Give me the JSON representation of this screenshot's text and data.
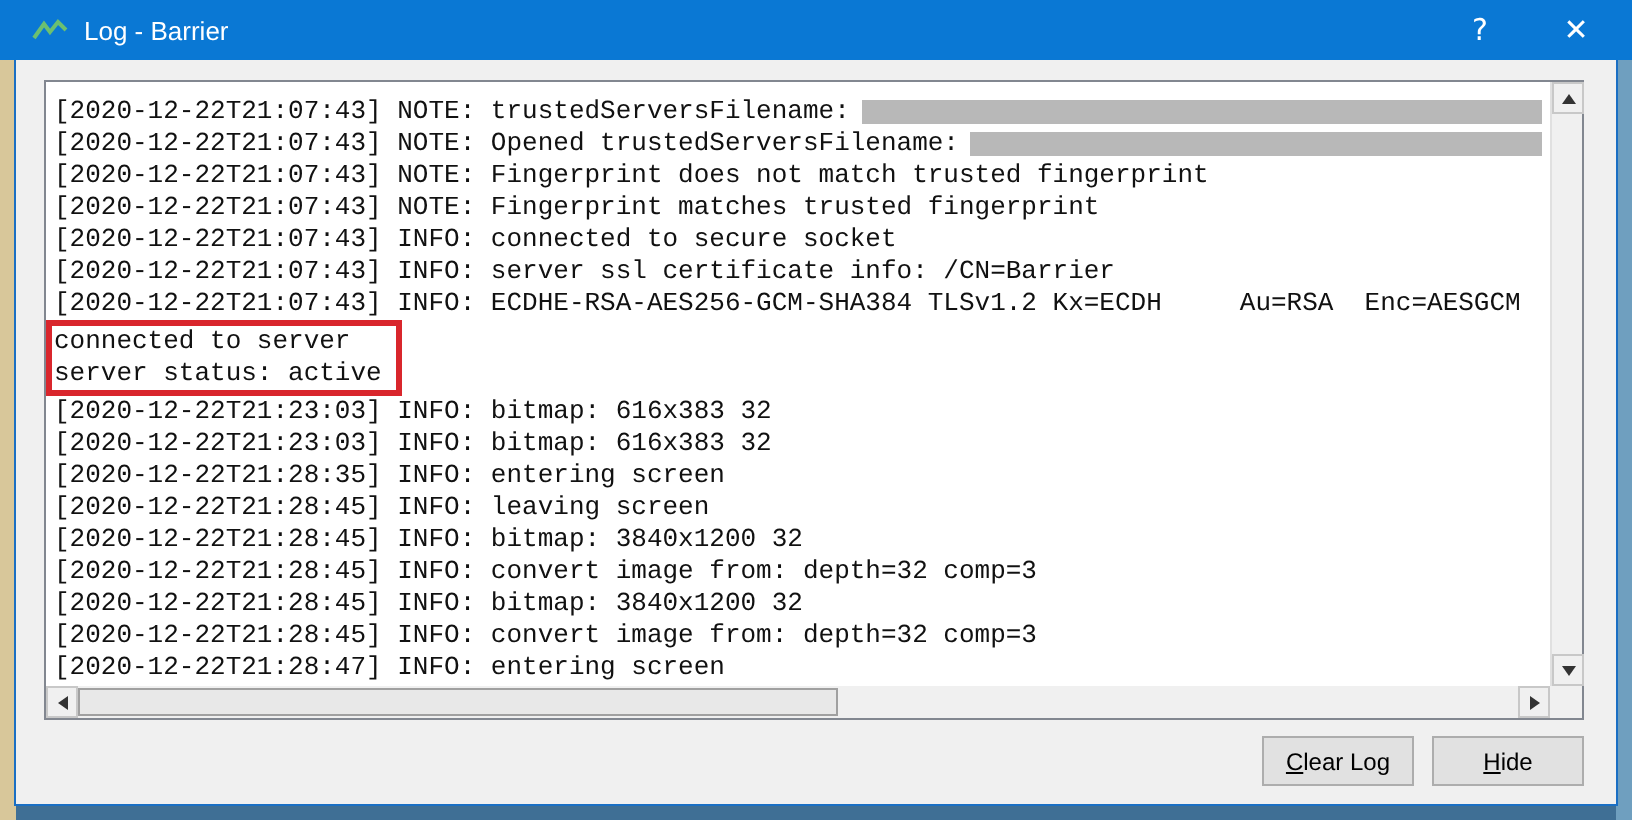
{
  "window": {
    "title": "Log - Barrier",
    "help": "?",
    "close": "✕"
  },
  "log_lines": [
    {
      "text": "[2020-12-22T21:07:43] NOTE: trustedServersFilename:",
      "redacted": true,
      "highlighted": false
    },
    {
      "text": "[2020-12-22T21:07:43] NOTE: Opened trustedServersFilename:",
      "redacted": true,
      "highlighted": false
    },
    {
      "text": "[2020-12-22T21:07:43] NOTE: Fingerprint does not match trusted fingerprint",
      "redacted": false,
      "highlighted": false
    },
    {
      "text": "[2020-12-22T21:07:43] NOTE: Fingerprint matches trusted fingerprint",
      "redacted": false,
      "highlighted": false
    },
    {
      "text": "[2020-12-22T21:07:43] INFO: connected to secure socket",
      "redacted": false,
      "highlighted": false
    },
    {
      "text": "[2020-12-22T21:07:43] INFO: server ssl certificate info: /CN=Barrier",
      "redacted": false,
      "highlighted": false
    },
    {
      "text": "[2020-12-22T21:07:43] INFO: ECDHE-RSA-AES256-GCM-SHA384 TLSv1.2 Kx=ECDH     Au=RSA  Enc=AESGCM",
      "redacted": false,
      "highlighted": false
    },
    {
      "text": "connected to server",
      "redacted": false,
      "highlighted": true
    },
    {
      "text": "server status: active",
      "redacted": false,
      "highlighted": true
    },
    {
      "text": "[2020-12-22T21:23:03] INFO: bitmap: 616x383 32",
      "redacted": false,
      "highlighted": false
    },
    {
      "text": "[2020-12-22T21:23:03] INFO: bitmap: 616x383 32",
      "redacted": false,
      "highlighted": false
    },
    {
      "text": "[2020-12-22T21:28:35] INFO: entering screen",
      "redacted": false,
      "highlighted": false
    },
    {
      "text": "[2020-12-22T21:28:45] INFO: leaving screen",
      "redacted": false,
      "highlighted": false
    },
    {
      "text": "[2020-12-22T21:28:45] INFO: bitmap: 3840x1200 32",
      "redacted": false,
      "highlighted": false
    },
    {
      "text": "[2020-12-22T21:28:45] INFO: convert image from: depth=32 comp=3",
      "redacted": false,
      "highlighted": false
    },
    {
      "text": "[2020-12-22T21:28:45] INFO: bitmap: 3840x1200 32",
      "redacted": false,
      "highlighted": false
    },
    {
      "text": "[2020-12-22T21:28:45] INFO: convert image from: depth=32 comp=3",
      "redacted": false,
      "highlighted": false
    },
    {
      "text": "[2020-12-22T21:28:47] INFO: entering screen",
      "redacted": false,
      "highlighted": false
    }
  ],
  "buttons": [
    "Clear Log",
    "Hide"
  ]
}
